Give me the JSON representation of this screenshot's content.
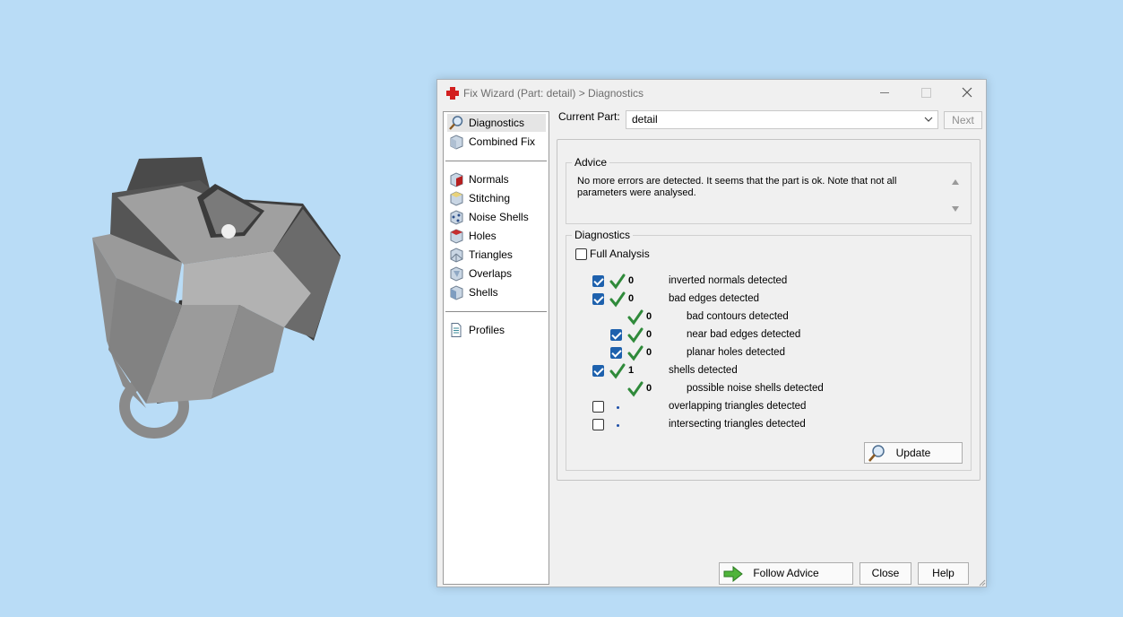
{
  "window": {
    "title": "Fix Wizard (Part: detail) > Diagnostics"
  },
  "nav": {
    "top": [
      {
        "label": "Diagnostics",
        "icon": "magnifier-icon",
        "selected": true
      },
      {
        "label": "Combined Fix",
        "icon": "cube-icon"
      }
    ],
    "tools": [
      {
        "label": "Normals",
        "icon": "normals-cube-icon"
      },
      {
        "label": "Stitching",
        "icon": "stitching-cube-icon"
      },
      {
        "label": "Noise Shells",
        "icon": "noise-shells-icon"
      },
      {
        "label": "Holes",
        "icon": "holes-cube-icon"
      },
      {
        "label": "Triangles",
        "icon": "triangles-cube-icon"
      },
      {
        "label": "Overlaps",
        "icon": "overlaps-cube-icon"
      },
      {
        "label": "Shells",
        "icon": "shells-cube-icon"
      }
    ],
    "bottom": [
      {
        "label": "Profiles",
        "icon": "document-icon"
      }
    ]
  },
  "current_part": {
    "label": "Current Part:",
    "value": "detail",
    "next_label": "Next"
  },
  "advice": {
    "title": "Advice",
    "text": "No more errors are detected. It seems that the part is ok. Note that not all parameters were analysed."
  },
  "diagnostics": {
    "title": "Diagnostics",
    "full_analysis_label": "Full Analysis",
    "full_analysis_checked": false,
    "rows": [
      {
        "checkbox": true,
        "checked": true,
        "status": "ok",
        "count": "0",
        "label": "inverted normals detected",
        "indent": 0
      },
      {
        "checkbox": true,
        "checked": true,
        "status": "ok",
        "count": "0",
        "label": "bad edges detected",
        "indent": 0
      },
      {
        "checkbox": false,
        "checked": false,
        "status": "ok",
        "count": "0",
        "label": "bad contours detected",
        "indent": 1
      },
      {
        "checkbox": true,
        "checked": true,
        "status": "ok",
        "count": "0",
        "label": "near bad edges detected",
        "indent": 1
      },
      {
        "checkbox": true,
        "checked": true,
        "status": "ok",
        "count": "0",
        "label": "planar holes detected",
        "indent": 1
      },
      {
        "checkbox": true,
        "checked": true,
        "status": "ok",
        "count": "1",
        "label": "shells detected",
        "indent": 0
      },
      {
        "checkbox": false,
        "checked": false,
        "status": "ok",
        "count": "0",
        "label": "possible noise shells detected",
        "indent": 1
      },
      {
        "checkbox": true,
        "checked": false,
        "status": "pending",
        "count": "",
        "label": "overlapping triangles detected",
        "indent": 0
      },
      {
        "checkbox": true,
        "checked": false,
        "status": "pending",
        "count": "",
        "label": "intersecting triangles detected",
        "indent": 0
      }
    ],
    "update_label": "Update"
  },
  "footer": {
    "follow_advice_label": "Follow Advice",
    "close_label": "Close",
    "help_label": "Help"
  },
  "colors": {
    "background": "#b9dcf6",
    "check_green": "#2f8a3a",
    "checkbox_blue": "#1e61ad",
    "brand_red": "#d21f1f"
  }
}
